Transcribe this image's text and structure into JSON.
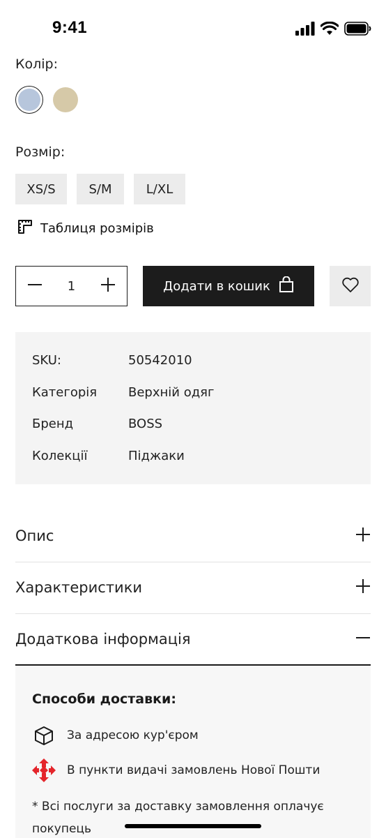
{
  "status_bar": {
    "time": "9:41"
  },
  "color": {
    "label": "Колір:",
    "swatches": [
      {
        "name": "light-blue",
        "hex": "#b7c6dc",
        "selected": true
      },
      {
        "name": "beige",
        "hex": "#d6c9a8",
        "selected": false
      }
    ]
  },
  "size": {
    "label": "Розмір:",
    "options": [
      "XS/S",
      "S/M",
      "L/XL"
    ],
    "chart_label": "Таблиця розмірів"
  },
  "purchase": {
    "quantity": "1",
    "add_to_cart_label": "Додати в кошик"
  },
  "meta": {
    "rows": [
      {
        "key": "SKU:",
        "value": "50542010"
      },
      {
        "key": "Категорія",
        "value": "Верхній одяг"
      },
      {
        "key": "Бренд",
        "value": "BOSS"
      },
      {
        "key": "Колекції",
        "value": "Піджаки"
      }
    ]
  },
  "accordion": [
    {
      "title": "Опис",
      "expanded": false
    },
    {
      "title": "Характеристики",
      "expanded": false
    },
    {
      "title": "Додаткова інформація",
      "expanded": true
    }
  ],
  "additional_info": {
    "title": "Способи доставки:",
    "methods": [
      {
        "icon": "box-icon",
        "label": "За адресою кур'єром"
      },
      {
        "icon": "nova-poshta-logo",
        "label": "В пункти видачі замовлень Нової Пошти"
      }
    ],
    "note": "* Всі послуги за доставку замовлення оплачує покупець"
  },
  "colors": {
    "primary": "#1c1c1c",
    "button_bg": "#ececec",
    "panel_bg": "#f4f4f4",
    "nova_poshta_red": "#e4252b"
  }
}
